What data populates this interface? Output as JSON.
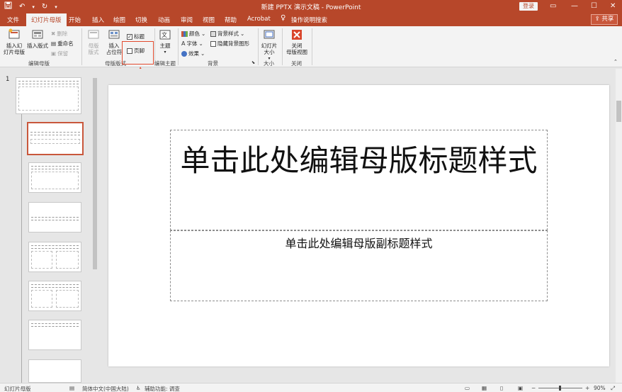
{
  "titlebar": {
    "title": "新建 PPTX 演示文稿 - PowerPoint",
    "login": "登录",
    "save_icon": "save-icon",
    "undo_icon": "undo-icon",
    "redo_icon": "redo-icon",
    "customize_icon": "customize-qat-icon"
  },
  "tabs": {
    "file": "文件",
    "slide_master": "幻灯片母版",
    "home": "开始",
    "insert": "插入",
    "draw": "绘图",
    "transitions": "切换",
    "animations": "动画",
    "review": "审阅",
    "view": "视图",
    "help": "帮助",
    "acrobat": "Acrobat",
    "tell_me": "操作说明搜索",
    "share": "共享"
  },
  "ribbon": {
    "insert_slide_master": "插入幻\n灯片母版",
    "insert_layout": "插入版式",
    "delete": "删除",
    "rename": "重命名",
    "preserve": "保留",
    "group_edit_master": "编辑母版",
    "master_layout": "母版\n版式",
    "insert_placeholder": "插入\n占位符",
    "title_check": "标题",
    "footer_check": "页脚",
    "group_master_layout": "母版版式",
    "themes": "主题",
    "group_edit_theme": "编辑主题",
    "colors": "颜色",
    "fonts": "字体",
    "effects": "效果",
    "background_styles": "背景样式",
    "hide_background": "隐藏背景图形",
    "group_background": "背景",
    "slide_size": "幻灯片\n大小",
    "group_size": "大小",
    "close_master_view": "关闭\n母版视图",
    "group_close": "关闭"
  },
  "thumbs": {
    "slide_number": "1"
  },
  "slide": {
    "title_placeholder": "单击此处编辑母版标题样式",
    "subtitle_placeholder": "单击此处编辑母版副标题样式"
  },
  "statusbar": {
    "view_name": "幻灯片母版",
    "language": "简体中文(中国大陆)",
    "accessibility": "辅助功能: 调查",
    "zoom": "90%"
  },
  "colors": {
    "accent": "#b7472a",
    "ribbon_bg": "#f3f3f3",
    "highlight": "#e24a2e"
  }
}
